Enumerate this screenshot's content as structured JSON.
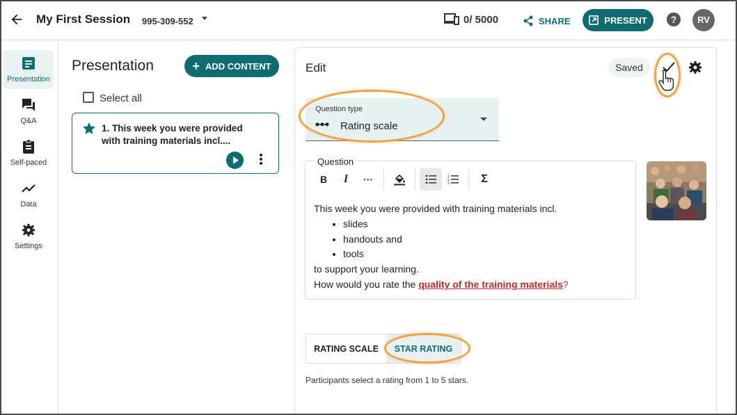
{
  "header": {
    "back_icon": "arrow-left-icon",
    "title": "My First Session",
    "session_code": "995-309-552",
    "participants": "0/ 5000",
    "share_label": "SHARE",
    "present_label": "PRESENT",
    "help_label": "?",
    "avatar_initials": "RV"
  },
  "nav": {
    "items": [
      {
        "label": "Presentation",
        "icon": "document-icon",
        "active": true
      },
      {
        "label": "Q&A",
        "icon": "chat-icon"
      },
      {
        "label": "Self-paced",
        "icon": "clipboard-icon"
      },
      {
        "label": "Data",
        "icon": "trend-line-icon"
      },
      {
        "label": "Settings",
        "icon": "gear-icon"
      }
    ]
  },
  "presentation": {
    "title": "Presentation",
    "add_content_label": "ADD CONTENT",
    "select_all_label": "Select all",
    "slides": [
      {
        "text": "1. This week you were provided with training materials incl...."
      }
    ]
  },
  "edit": {
    "title": "Edit",
    "saved_label": "Saved",
    "question_type_label": "Question type",
    "question_type_value": "Rating scale",
    "question_label": "Question",
    "toolbar": [
      "B",
      "I",
      "···",
      "fill",
      "bullet-list",
      "numbered-list",
      "Σ"
    ],
    "question": {
      "intro": "This week you were provided with training materials incl.",
      "bullets": [
        "slides",
        "handouts and",
        "tools"
      ],
      "support": "to support your learning.",
      "ask_prefix": "How would you rate the ",
      "ask_link": "quality of the training materials",
      "ask_suffix": "?"
    },
    "rating_tabs": [
      "RATING SCALE",
      "STAR RATING"
    ],
    "active_rating_tab": "STAR RATING",
    "rating_description": "Participants select a rating from 1 to 5 stars."
  },
  "colors": {
    "accent": "#0e6b70",
    "highlight": "#f0a244",
    "link": "#c62828"
  }
}
